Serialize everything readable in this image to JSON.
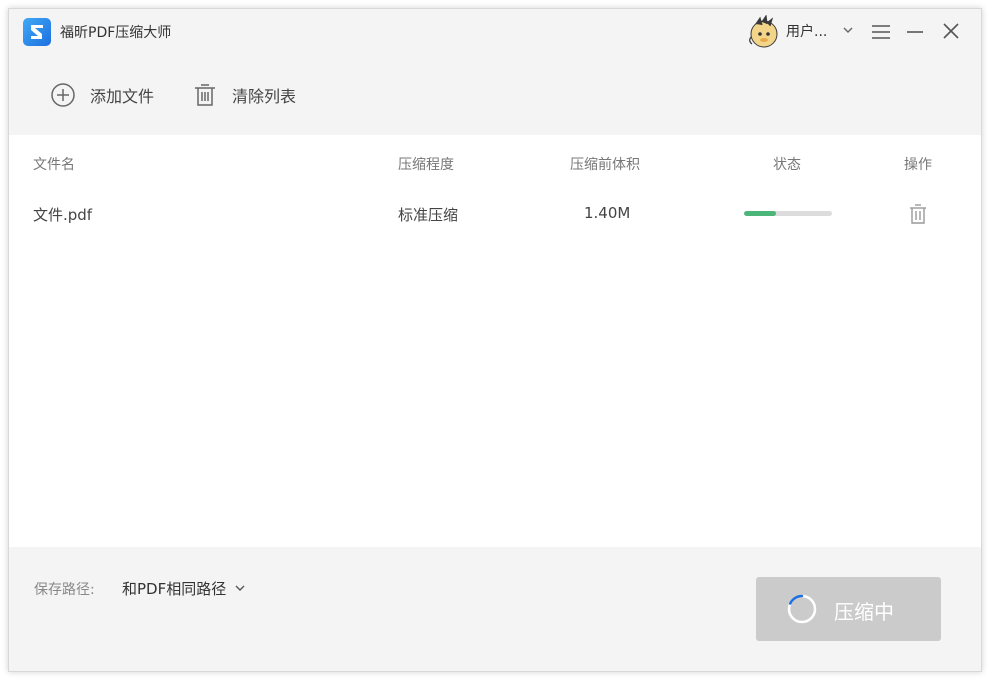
{
  "app": {
    "title": "福昕PDF压缩大师"
  },
  "user": {
    "name": "用户..."
  },
  "toolbar": {
    "add_label": "添加文件",
    "clear_label": "清除列表"
  },
  "table": {
    "headers": {
      "name": "文件名",
      "level": "压缩程度",
      "size": "压缩前体积",
      "status": "状态",
      "action": "操作"
    },
    "rows": [
      {
        "name": "文件.pdf",
        "level": "标准压缩",
        "size": "1.40M",
        "progress": 0.36
      }
    ]
  },
  "footer": {
    "save_label": "保存路径:",
    "save_path": "和PDF相同路径",
    "compress_label": "压缩中"
  },
  "colors": {
    "accent": "#1e6fe0",
    "progress": "#4cb57a",
    "button_disabled": "#cbcbcb"
  }
}
